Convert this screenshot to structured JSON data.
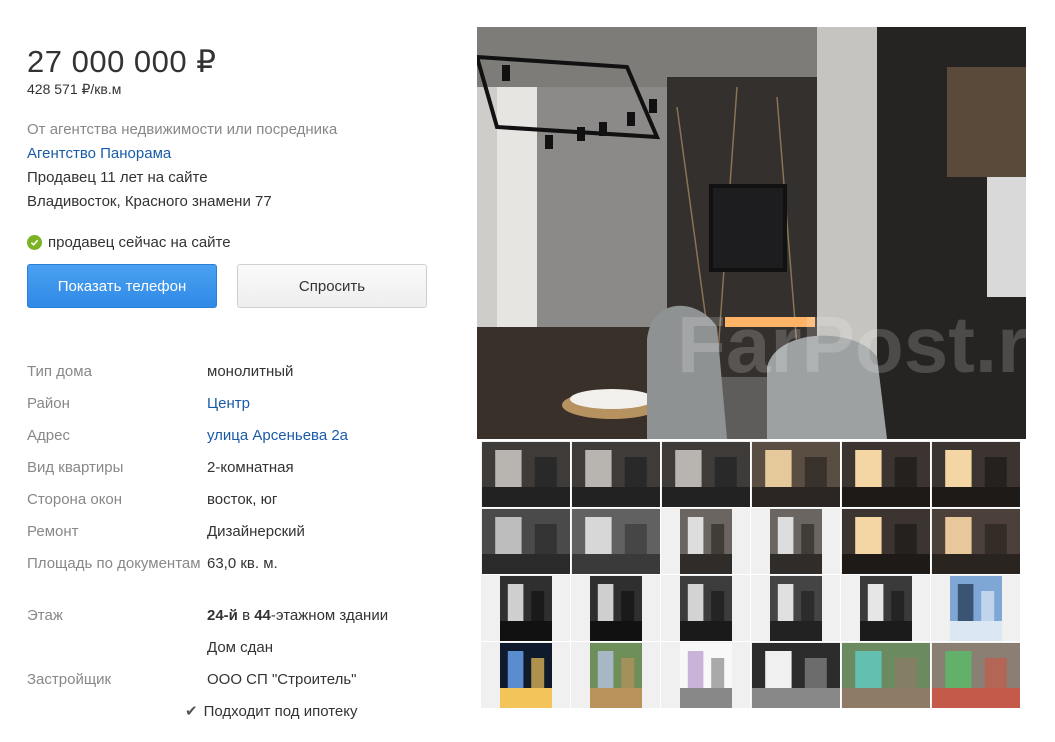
{
  "price": {
    "total": "27 000 000 ₽",
    "per_sqm": "428 571 ₽/кв.м"
  },
  "seller": {
    "type_text": "От агентства недвижимости или посредника",
    "agency_name": "Агентство Панорама",
    "tenure": "Продавец 11 лет на сайте",
    "address": "Владивосток, Красного знамени 77",
    "online_status": "продавец сейчас на сайте"
  },
  "actions": {
    "show_phone": "Показать телефон",
    "ask": "Спросить"
  },
  "properties": [
    {
      "key": "Тип дома",
      "value": "монолитный"
    },
    {
      "key": "Район",
      "value": "Центр"
    },
    {
      "key": "Адрес",
      "value": "улица Арсеньева 2а"
    },
    {
      "key": "Вид квартиры",
      "value": "2-комнатная"
    },
    {
      "key": "Сторона окон",
      "value": "восток, юг"
    },
    {
      "key": "Ремонт",
      "value": "Дизайнерский"
    },
    {
      "key": "Площадь по документам",
      "value": "63,0 кв. м."
    },
    {
      "key": "Этаж",
      "value_parts": [
        "24-й",
        " в ",
        "44",
        "-этажном здании"
      ]
    },
    {
      "key": "",
      "value": "Дом сдан"
    },
    {
      "key": "Застройщик",
      "value": "ООО СП \"Строитель\""
    },
    {
      "key": "",
      "value": "Подходит под ипотеку"
    }
  ],
  "watermark": "FarPost.ru",
  "colors": {
    "link": "#1a5ba8",
    "primary_button": "#3b93ec",
    "online_dot": "#7bb325",
    "muted_text": "#888888"
  },
  "thumbnails": [
    {
      "kind": "interior-dark-wide"
    },
    {
      "kind": "interior-dark-wide"
    },
    {
      "kind": "interior-dark-wide"
    },
    {
      "kind": "kitchen-wide"
    },
    {
      "kind": "bedroom-wide"
    },
    {
      "kind": "bedroom-wide"
    },
    {
      "kind": "hallway-wide"
    },
    {
      "kind": "door-wide"
    },
    {
      "kind": "corridor-narrow"
    },
    {
      "kind": "corridor-narrow"
    },
    {
      "kind": "bedroom-wide"
    },
    {
      "kind": "wardrobe-wide"
    },
    {
      "kind": "bathroom-narrow"
    },
    {
      "kind": "bathroom-narrow"
    },
    {
      "kind": "laundry-narrow"
    },
    {
      "kind": "toilet-narrow"
    },
    {
      "kind": "shower-narrow"
    },
    {
      "kind": "building-narrow"
    },
    {
      "kind": "night-city-narrow"
    },
    {
      "kind": "aerial-narrow"
    },
    {
      "kind": "floorplan-narrow"
    },
    {
      "kind": "lobby-wide"
    },
    {
      "kind": "playground-wide"
    },
    {
      "kind": "courtyard-wide"
    }
  ]
}
